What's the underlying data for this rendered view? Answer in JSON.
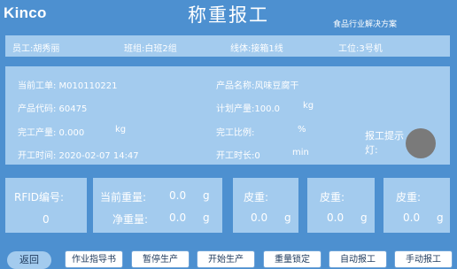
{
  "header": {
    "brand": "Kinco",
    "title": "称重报工",
    "subtitle": "食品行业解决方案"
  },
  "info_bar": {
    "employee": "员工:胡秀丽",
    "team": "班组:白班2组",
    "line": "线体:接箱1线",
    "station": "工位:3号机"
  },
  "main": {
    "work_order": "当前工单: M010110221",
    "product_name": "产品名称:风味豆腐干",
    "product_code": "产品代码: 60475",
    "planned_qty": "计划产量:100.0",
    "planned_unit": "kg",
    "completed_qty": "完工产量: 0.000",
    "completed_unit": "kg",
    "completed_ratio_label": "完工比例:",
    "completed_ratio_unit": "%",
    "start_time": "开工时间:  2020-02-07 14:47",
    "duration_label": "开工时长:0",
    "duration_unit": "min",
    "lamp_label": "报工提示灯:",
    "lamp_color": "#7a7a7a"
  },
  "weights": {
    "rfid_label": "RFID编号:",
    "rfid_value": "0",
    "current_weight_label": "当前重量:",
    "current_weight_value": "0.0",
    "current_weight_unit": "g",
    "net_weight_label": "净重量:",
    "net_weight_value": "0.0",
    "net_weight_unit": "g",
    "tare1_label": "皮重:",
    "tare1_value": "0.0",
    "tare1_unit": "g",
    "tare2_label": "皮重:",
    "tare2_value": "0.0",
    "tare2_unit": "g",
    "tare3_label": "皮重:",
    "tare3_value": "0.0",
    "tare3_unit": "g"
  },
  "buttons": {
    "back": "返回",
    "work_guide": "作业指导书",
    "pause": "暂停生产",
    "start": "开始生产",
    "lock_weight": "重量锁定",
    "auto_report": "自动报工",
    "manual_report": "手动报工"
  }
}
